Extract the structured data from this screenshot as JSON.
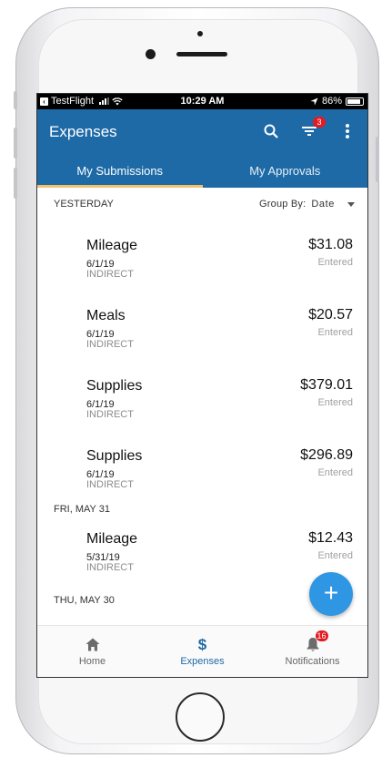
{
  "status_bar": {
    "carrier": "TestFlight",
    "time": "10:29 AM",
    "battery": "86%"
  },
  "app_bar": {
    "title": "Expenses",
    "filter_badge": "3"
  },
  "tabs": [
    {
      "label": "My Submissions",
      "active": true
    },
    {
      "label": "My Approvals",
      "active": false
    }
  ],
  "group_by": {
    "label": "Group By:",
    "value": "Date"
  },
  "sections": [
    {
      "header": "YESTERDAY",
      "items": [
        {
          "name": "Mileage",
          "date": "6/1/19",
          "category": "INDIRECT",
          "amount": "$31.08",
          "status": "Entered"
        },
        {
          "name": "Meals",
          "date": "6/1/19",
          "category": "INDIRECT",
          "amount": "$20.57",
          "status": "Entered"
        },
        {
          "name": "Supplies",
          "date": "6/1/19",
          "category": "INDIRECT",
          "amount": "$379.01",
          "status": "Entered"
        },
        {
          "name": "Supplies",
          "date": "6/1/19",
          "category": "INDIRECT",
          "amount": "$296.89",
          "status": "Entered"
        }
      ]
    },
    {
      "header": "FRI, MAY 31",
      "items": [
        {
          "name": "Mileage",
          "date": "5/31/19",
          "category": "INDIRECT",
          "amount": "$12.43",
          "status": "Entered"
        }
      ]
    },
    {
      "header": "THU, MAY 30",
      "items": []
    }
  ],
  "fab": {
    "label": "+"
  },
  "bottom_nav": [
    {
      "label": "Home",
      "icon": "home-icon",
      "active": false
    },
    {
      "label": "Expenses",
      "icon": "dollar-icon",
      "active": true
    },
    {
      "label": "Notifications",
      "icon": "bell-icon",
      "active": false,
      "badge": "16"
    }
  ],
  "colors": {
    "primary": "#1e6aa6",
    "tab_indicator": "#f2c36b",
    "fab": "#2f96e3",
    "badge": "#e31b23"
  }
}
